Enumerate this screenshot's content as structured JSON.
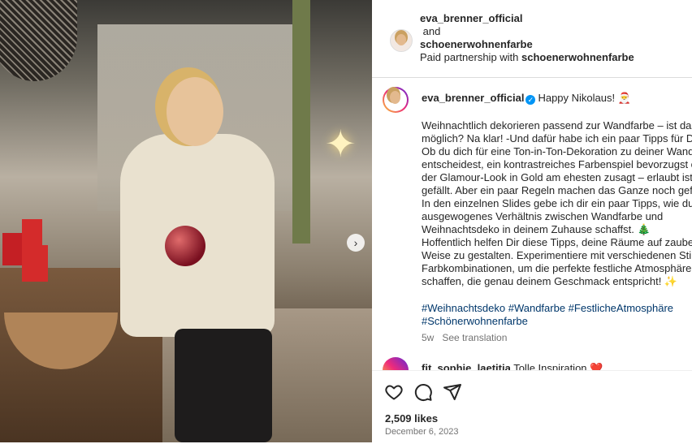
{
  "header": {
    "author": "eva_brenner_official",
    "connector": "and",
    "coauthor": "schoenerwohnenfarbe",
    "paid_prefix": "Paid partnership with",
    "paid_partner": "schoenerwohnenfarbe"
  },
  "caption": {
    "username": "eva_brenner_official",
    "headline": "Happy Nikolaus! 🎅",
    "lines": [
      "Weihnachtlich dekorieren passend zur Wandfarbe – ist das",
      "möglich? Na klar! -Und dafür habe ich ein paar Tipps für Dich:",
      "Ob du dich für eine Ton-in-Ton-Dekoration zu deiner Wandfarbe",
      "entscheidest, ein kontrastreiches Farbenspiel bevorzugst oder",
      "der Glamour-Look in Gold am ehesten zusagt – erlaubt ist, was",
      "gefällt. Aber ein paar Regeln machen das Ganze noch gefälliger.",
      "In den einzelnen Slides gebe ich dir ein paar Tipps, wie du ein",
      "ausgewogenes Verhältnis zwischen Wandfarbe und",
      "Weihnachtsdeko in deinem Zuhause schaffst. 🎄",
      "Hoffentlich helfen Dir diese Tipps, deine Räume auf zauberhafte",
      "Weise zu gestalten. Experimentiere mit verschiedenen Stilen und",
      "Farbkombinationen, um die perfekte festliche Atmosphäre zu",
      "schaffen, die genau deinem Geschmack entspricht! ✨"
    ],
    "tags_line1": "#Weihnachtsdeko #Wandfarbe #FestlicheAtmosphäre",
    "tags_line2": "#Schönerwohnenfarbe",
    "age": "5w",
    "see_translation": "See translation"
  },
  "next_comment": {
    "username": "fit_sophie_laetitia",
    "text": "Tolle Inspiration ❤️"
  },
  "stats": {
    "likes": "2,509 likes",
    "date": "December 6, 2023"
  },
  "icons": [
    "heart-icon",
    "comment-icon",
    "share-icon",
    "chevron-right-icon",
    "verified-icon"
  ],
  "colors": {
    "link": "#00376b",
    "verified": "#0095f6",
    "muted": "#737373"
  }
}
